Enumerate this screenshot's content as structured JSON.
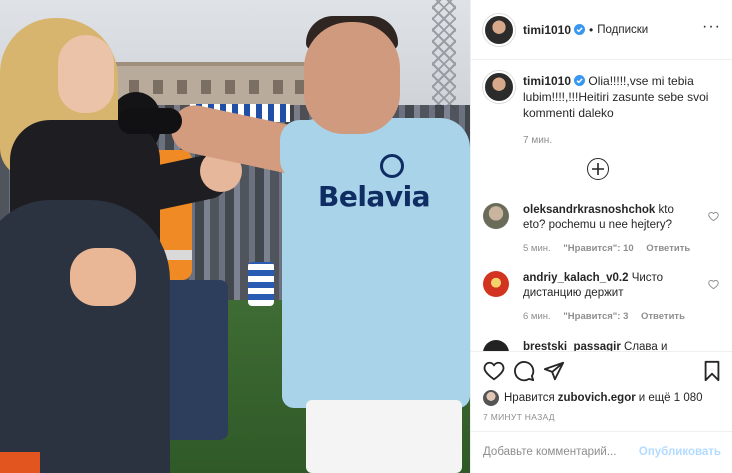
{
  "header": {
    "username": "timi1010",
    "separator": "•",
    "follow_label": "Подписки",
    "more_label": "···"
  },
  "caption": {
    "username": "timi1010",
    "text": "Olia!!!!!,vse mi tebia lubim!!!!,!!!Heitiri zasunte sebe svoi kommenti daleko",
    "time": "7 мин."
  },
  "comments": [
    {
      "username": "oleksandrkrasnoshchok",
      "text": "kto eto? pochemu u nee hejtery?",
      "time": "5 мин.",
      "likes": "\"Нравится\": 10",
      "reply": "Ответить"
    },
    {
      "username": "andriy_kalach_v0.2",
      "text": "Чисто дистанцию держит",
      "time": "6 мин.",
      "likes": "\"Нравится\": 3",
      "reply": "Ответить"
    },
    {
      "username": "brestski_passagir",
      "text": "Слава и Жыве!"
    }
  ],
  "likes": {
    "prefix": "Нравится",
    "user": "zubovich.egor",
    "suffix": "и ещё 1 080"
  },
  "timestamp": "7 МИНУТ НАЗАД",
  "add_comment": {
    "placeholder": "Добавьте комментарий...",
    "publish": "Опубликовать"
  },
  "photo": {
    "sponsor": "Belavia"
  },
  "icons": [
    "heart-icon",
    "comment-icon",
    "share-icon",
    "bookmark-icon",
    "verified-icon",
    "plus-circle-icon"
  ],
  "colors": {
    "link_disabled": "#b3dbff",
    "secondary_text": "#8e8e8e",
    "verified": "#3897f0"
  }
}
